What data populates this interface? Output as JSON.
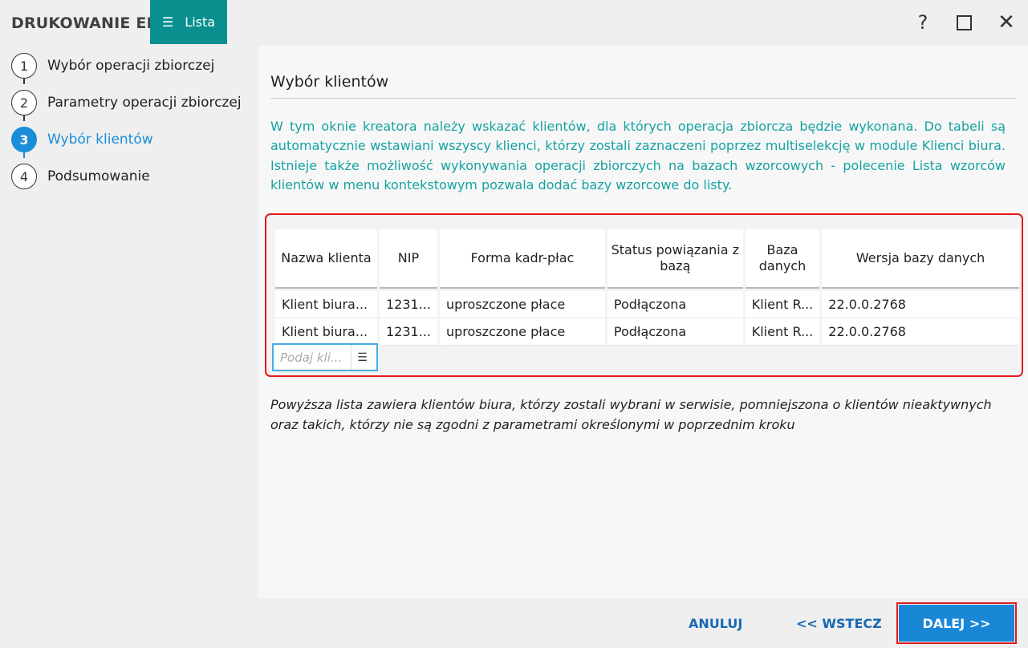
{
  "header": {
    "app_title": "DRUKOWANIE EP",
    "lista_label": "Lista",
    "help_glyph": "?",
    "close_glyph": "✕"
  },
  "steps": [
    {
      "num": "1",
      "label": "Wybór operacji zbiorczej",
      "active": false
    },
    {
      "num": "2",
      "label": "Parametry operacji zbiorczej",
      "active": false
    },
    {
      "num": "3",
      "label": "Wybór klientów",
      "active": true
    },
    {
      "num": "4",
      "label": "Podsumowanie",
      "active": false
    }
  ],
  "main": {
    "title": "Wybór klientów",
    "info": "W tym oknie kreatora należy wskazać klientów, dla których operacja zbiorcza będzie wykonana. Do tabeli są automatycznie wstawiani wszyscy klienci, którzy zostali zaznaczeni poprzez multiselekcję w module Klienci biura. Istnieje także możliwość wykonywania operacji zbiorczych na bazach wzorcowych - polecenie Lista wzorców klientów w menu kontekstowym pozwala dodać bazy wzorcowe do listy.",
    "table": {
      "columns": [
        "Nazwa klienta",
        "NIP",
        "Forma kadr-płac",
        "Status powiązania z bazą",
        "Baza danych",
        "Wersja bazy danych"
      ],
      "rows": [
        [
          "Klient biura...",
          "1231...",
          "uproszczone płace",
          "Podłączona",
          "Klient R...",
          "22.0.0.2768"
        ],
        [
          "Klient biura...",
          "1231...",
          "uproszczone płace",
          "Podłączona",
          "Klient R...",
          "22.0.0.2768"
        ]
      ]
    },
    "search_placeholder": "Podaj kli...",
    "note": "Powyższa lista zawiera klientów biura, którzy zostali wybrani w serwisie, pomniejszona o klientów nieaktywnych oraz takich, którzy nie są zgodni z parametrami określonymi w poprzednim kroku"
  },
  "footer": {
    "cancel_label": "ANULUJ",
    "back_label": "<< WSTECZ",
    "next_label": "DALEJ >>"
  },
  "colors": {
    "accent_teal": "#0a8f8f",
    "accent_blue": "#1a8ed8",
    "info_text": "#17a2a2",
    "highlight_red": "#e31b1b"
  }
}
